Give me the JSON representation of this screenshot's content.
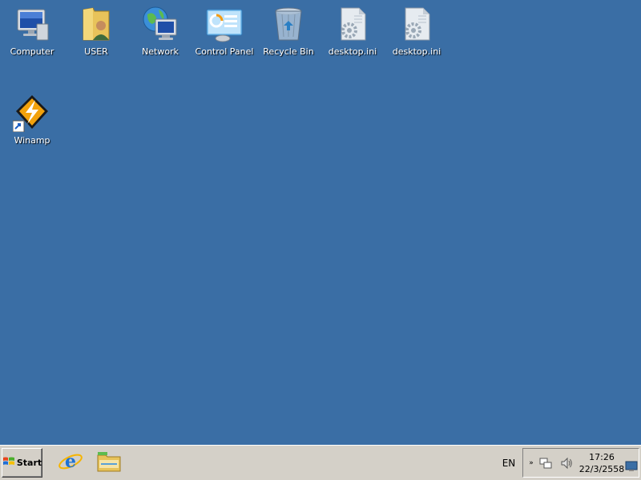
{
  "desktop": {
    "background_color": "#3a6ea5",
    "icons": [
      {
        "label": "Computer",
        "icon": "computer-icon"
      },
      {
        "label": "USER",
        "icon": "user-folder-icon"
      },
      {
        "label": "Network",
        "icon": "network-icon"
      },
      {
        "label": "Control Panel",
        "icon": "control-panel-icon"
      },
      {
        "label": "Recycle Bin",
        "icon": "recycle-bin-icon"
      },
      {
        "label": "desktop.ini",
        "icon": "settings-file-icon"
      },
      {
        "label": "desktop.ini",
        "icon": "settings-file-icon"
      },
      {
        "label": "Winamp",
        "icon": "winamp-shortcut-icon"
      }
    ]
  },
  "taskbar": {
    "start_label": "Start",
    "quick_launch": [
      {
        "icon": "internet-explorer-icon"
      },
      {
        "icon": "windows-explorer-icon"
      }
    ],
    "language": "EN",
    "tray": {
      "expand_glyph": "»",
      "icons": [
        "network-status-icon",
        "volume-icon"
      ],
      "time": "17:26",
      "date": "22/3/2558",
      "show_desktop_icon": "show-desktop-icon"
    }
  }
}
